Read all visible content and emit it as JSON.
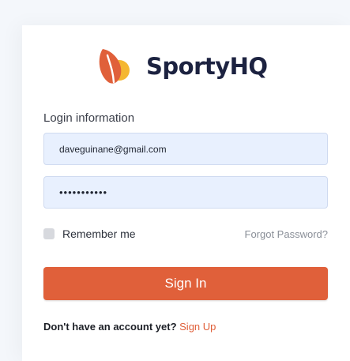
{
  "brand": {
    "name": "SportyHQ",
    "logo_icon": "sportyhq-leaf-logo-icon",
    "colors": {
      "orange": "#e0603a",
      "yellow": "#f5b731",
      "navy": "#1c2240"
    }
  },
  "form": {
    "section_label": "Login information",
    "email": {
      "value": "daveguinane@gmail.com"
    },
    "password": {
      "value": "•••••••••••"
    },
    "remember_label": "Remember me",
    "remember_checked": false,
    "forgot_label": "Forgot Password?",
    "submit_label": "Sign In"
  },
  "footer": {
    "prompt": "Don't have an account yet?",
    "signup_label": "Sign Up"
  }
}
